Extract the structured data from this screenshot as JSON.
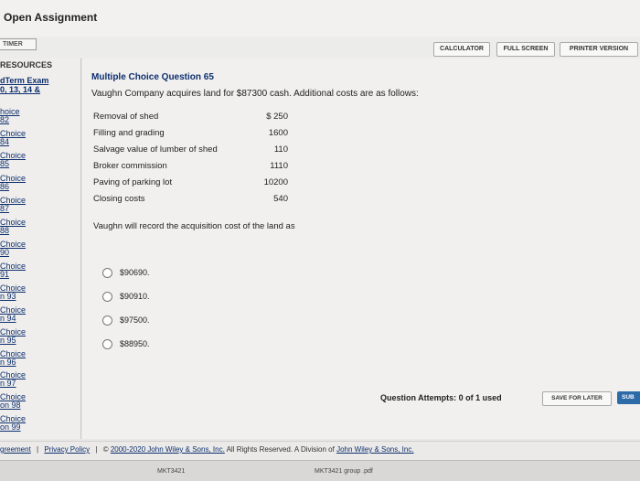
{
  "window": {
    "title": "Open Assignment"
  },
  "toolbar": {
    "timer_label": "TIMER",
    "calculator_label": "CALCULATOR",
    "fullscreen_label": "FULL SCREEN",
    "printer_label": "PRINTER VERSION"
  },
  "sidebar": {
    "resources_label": "RESOURCES",
    "exam_title_line1": "dTerm Exam",
    "exam_title_line2": "0, 13, 14 &",
    "items": [
      "hoice",
      "82",
      "Choice",
      "84",
      "Choice",
      "85",
      "Choice",
      "86",
      "Choice",
      "87",
      "Choice",
      "88",
      "Choice",
      "90",
      "Choice",
      "91",
      "Choice",
      "n 93",
      "Choice",
      "n 94",
      "Choice",
      "n 95",
      "Choice",
      "n 96",
      "Choice",
      "n 97",
      "Choice",
      "on 98",
      "Choice",
      "on 99"
    ]
  },
  "question": {
    "title": "Multiple Choice Question 65",
    "text": "Vaughn Company acquires land for $87300 cash. Additional costs are as follows:",
    "costs": [
      {
        "label": "Removal of shed",
        "value": "$ 250"
      },
      {
        "label": "Filling and grading",
        "value": "1600"
      },
      {
        "label": "Salvage value of lumber of shed",
        "value": "110"
      },
      {
        "label": "Broker commission",
        "value": "1110"
      },
      {
        "label": "Paving of parking lot",
        "value": "10200"
      },
      {
        "label": "Closing costs",
        "value": "540"
      }
    ],
    "prompt": "Vaughn will record the acquisition cost of the land as",
    "options": [
      "$90690.",
      "$90910.",
      "$97500.",
      "$88950."
    ]
  },
  "status": {
    "attempts": "Question Attempts: 0 of 1 used",
    "save_label": "SAVE FOR LATER",
    "submit_label": "SUB"
  },
  "footer": {
    "agreement": "greement",
    "separator1": "|",
    "privacy": "Privacy Policy",
    "separator2": "|",
    "copyright_prefix": "©",
    "copyright_link": "2000-2020 John Wiley & Sons, Inc.",
    "rights": "All Rights Reserved. A Division of",
    "company_link": "John Wiley & Sons, Inc."
  },
  "downloads": {
    "item1": "MKT3421",
    "item2": "MKT3421 group .pdf"
  }
}
